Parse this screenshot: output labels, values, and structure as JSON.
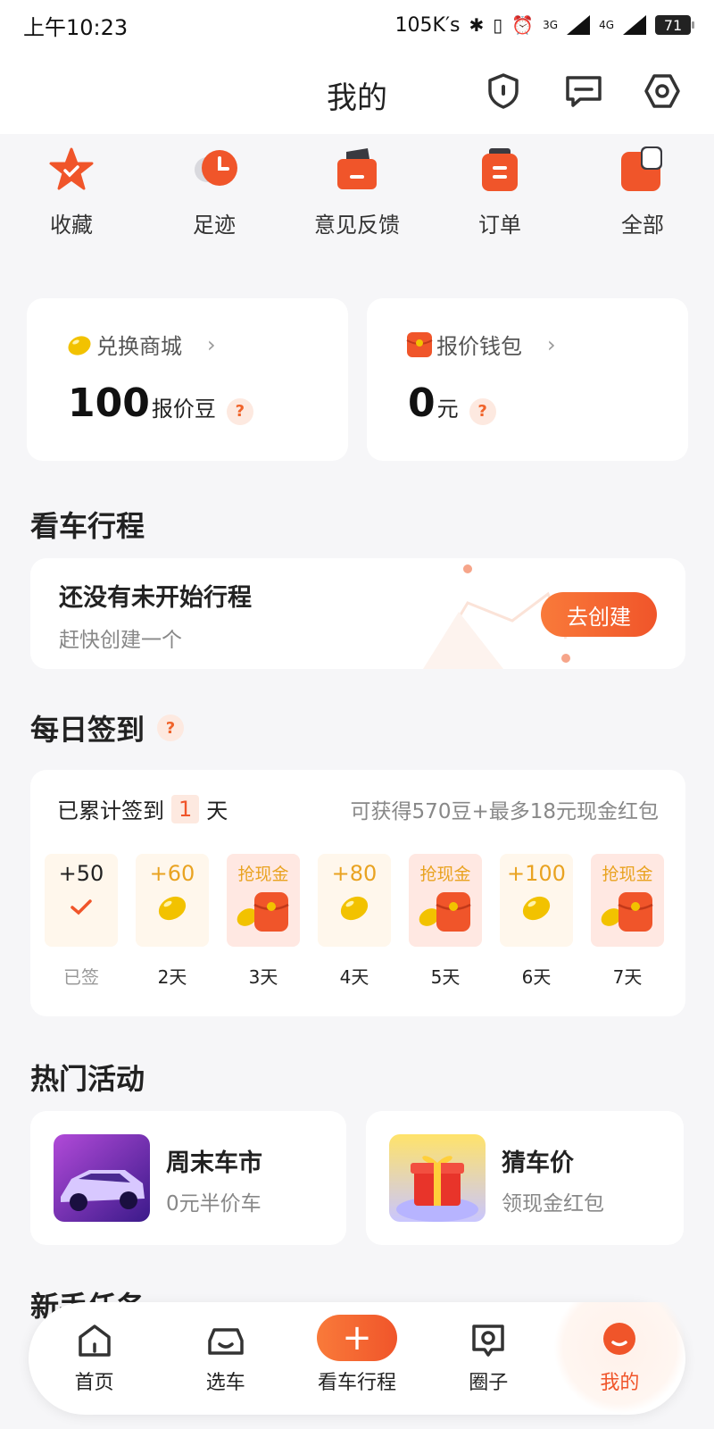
{
  "statusbar": {
    "time": "上午10:23",
    "speed": "105K′s",
    "net1": "3G",
    "net2": "4G",
    "battery": "71"
  },
  "header": {
    "title": "我的"
  },
  "quick_menu": [
    {
      "label": "收藏"
    },
    {
      "label": "足迹"
    },
    {
      "label": "意见反馈"
    },
    {
      "label": "订单"
    },
    {
      "label": "全部"
    }
  ],
  "mall": {
    "title": "兑换商城",
    "value": "100",
    "unit": "报价豆"
  },
  "wallet": {
    "title": "报价钱包",
    "value": "0",
    "unit": "元"
  },
  "trip": {
    "section_title": "看车行程",
    "title": "还没有未开始行程",
    "subtitle": "赶快创建一个",
    "button": "去创建"
  },
  "checkin": {
    "section_title": "每日签到",
    "prefix": "已累计签到",
    "days": "1",
    "suffix": "天",
    "reward_hint": "可获得570豆+最多18元现金红包",
    "days_list": [
      {
        "reward": "+50",
        "label": "已签",
        "type": "done"
      },
      {
        "reward": "+60",
        "label": "2天",
        "type": "bean"
      },
      {
        "reward": "抢现金",
        "label": "3天",
        "type": "cash"
      },
      {
        "reward": "+80",
        "label": "4天",
        "type": "bean"
      },
      {
        "reward": "抢现金",
        "label": "5天",
        "type": "cash"
      },
      {
        "reward": "+100",
        "label": "6天",
        "type": "bean"
      },
      {
        "reward": "抢现金",
        "label": "7天",
        "type": "cash"
      }
    ]
  },
  "activities": {
    "section_title": "热门活动",
    "items": [
      {
        "title": "周末车市",
        "subtitle": "0元半价车"
      },
      {
        "title": "猜车价",
        "subtitle": "领现金红包"
      }
    ]
  },
  "newbie": {
    "section_title": "新手任务"
  },
  "nav": [
    {
      "label": "首页"
    },
    {
      "label": "选车"
    },
    {
      "label": "看车行程"
    },
    {
      "label": "圈子"
    },
    {
      "label": "我的"
    }
  ],
  "colors": {
    "accent": "#f0552a",
    "bean": "#f2c200",
    "bg": "#f6f6f8"
  }
}
